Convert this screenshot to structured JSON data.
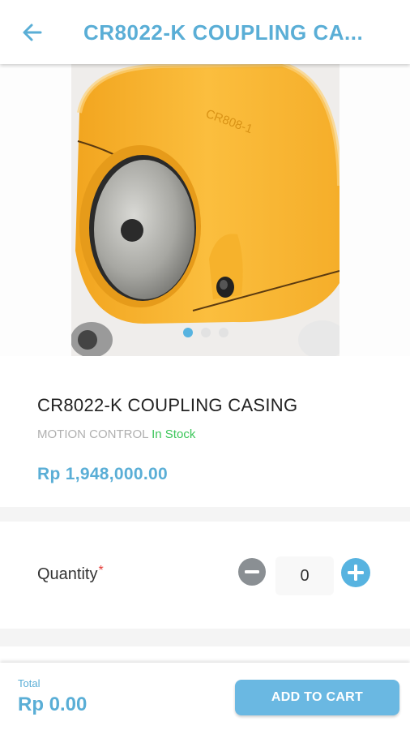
{
  "app_bar": {
    "title": "CR8022-K COUPLING CA...",
    "back_icon": "arrow-left-icon",
    "accent_color": "#5aaed6"
  },
  "gallery": {
    "image_count": 3,
    "active_index": 0,
    "image_text": "CR808-1"
  },
  "product": {
    "name": "CR8022-K COUPLING CASING",
    "category": "MOTION CONTROL",
    "stock_status": "In Stock",
    "stock_color": "#3cc65a",
    "price": "Rp 1,948,000.00"
  },
  "quantity": {
    "label": "Quantity",
    "required_mark": "*",
    "value": "0",
    "minus_icon": "minus-circle-icon",
    "plus_icon": "plus-circle-icon"
  },
  "footer": {
    "total_label": "Total",
    "total_value": "Rp 0.00",
    "add_to_cart_label": "ADD TO CART"
  }
}
